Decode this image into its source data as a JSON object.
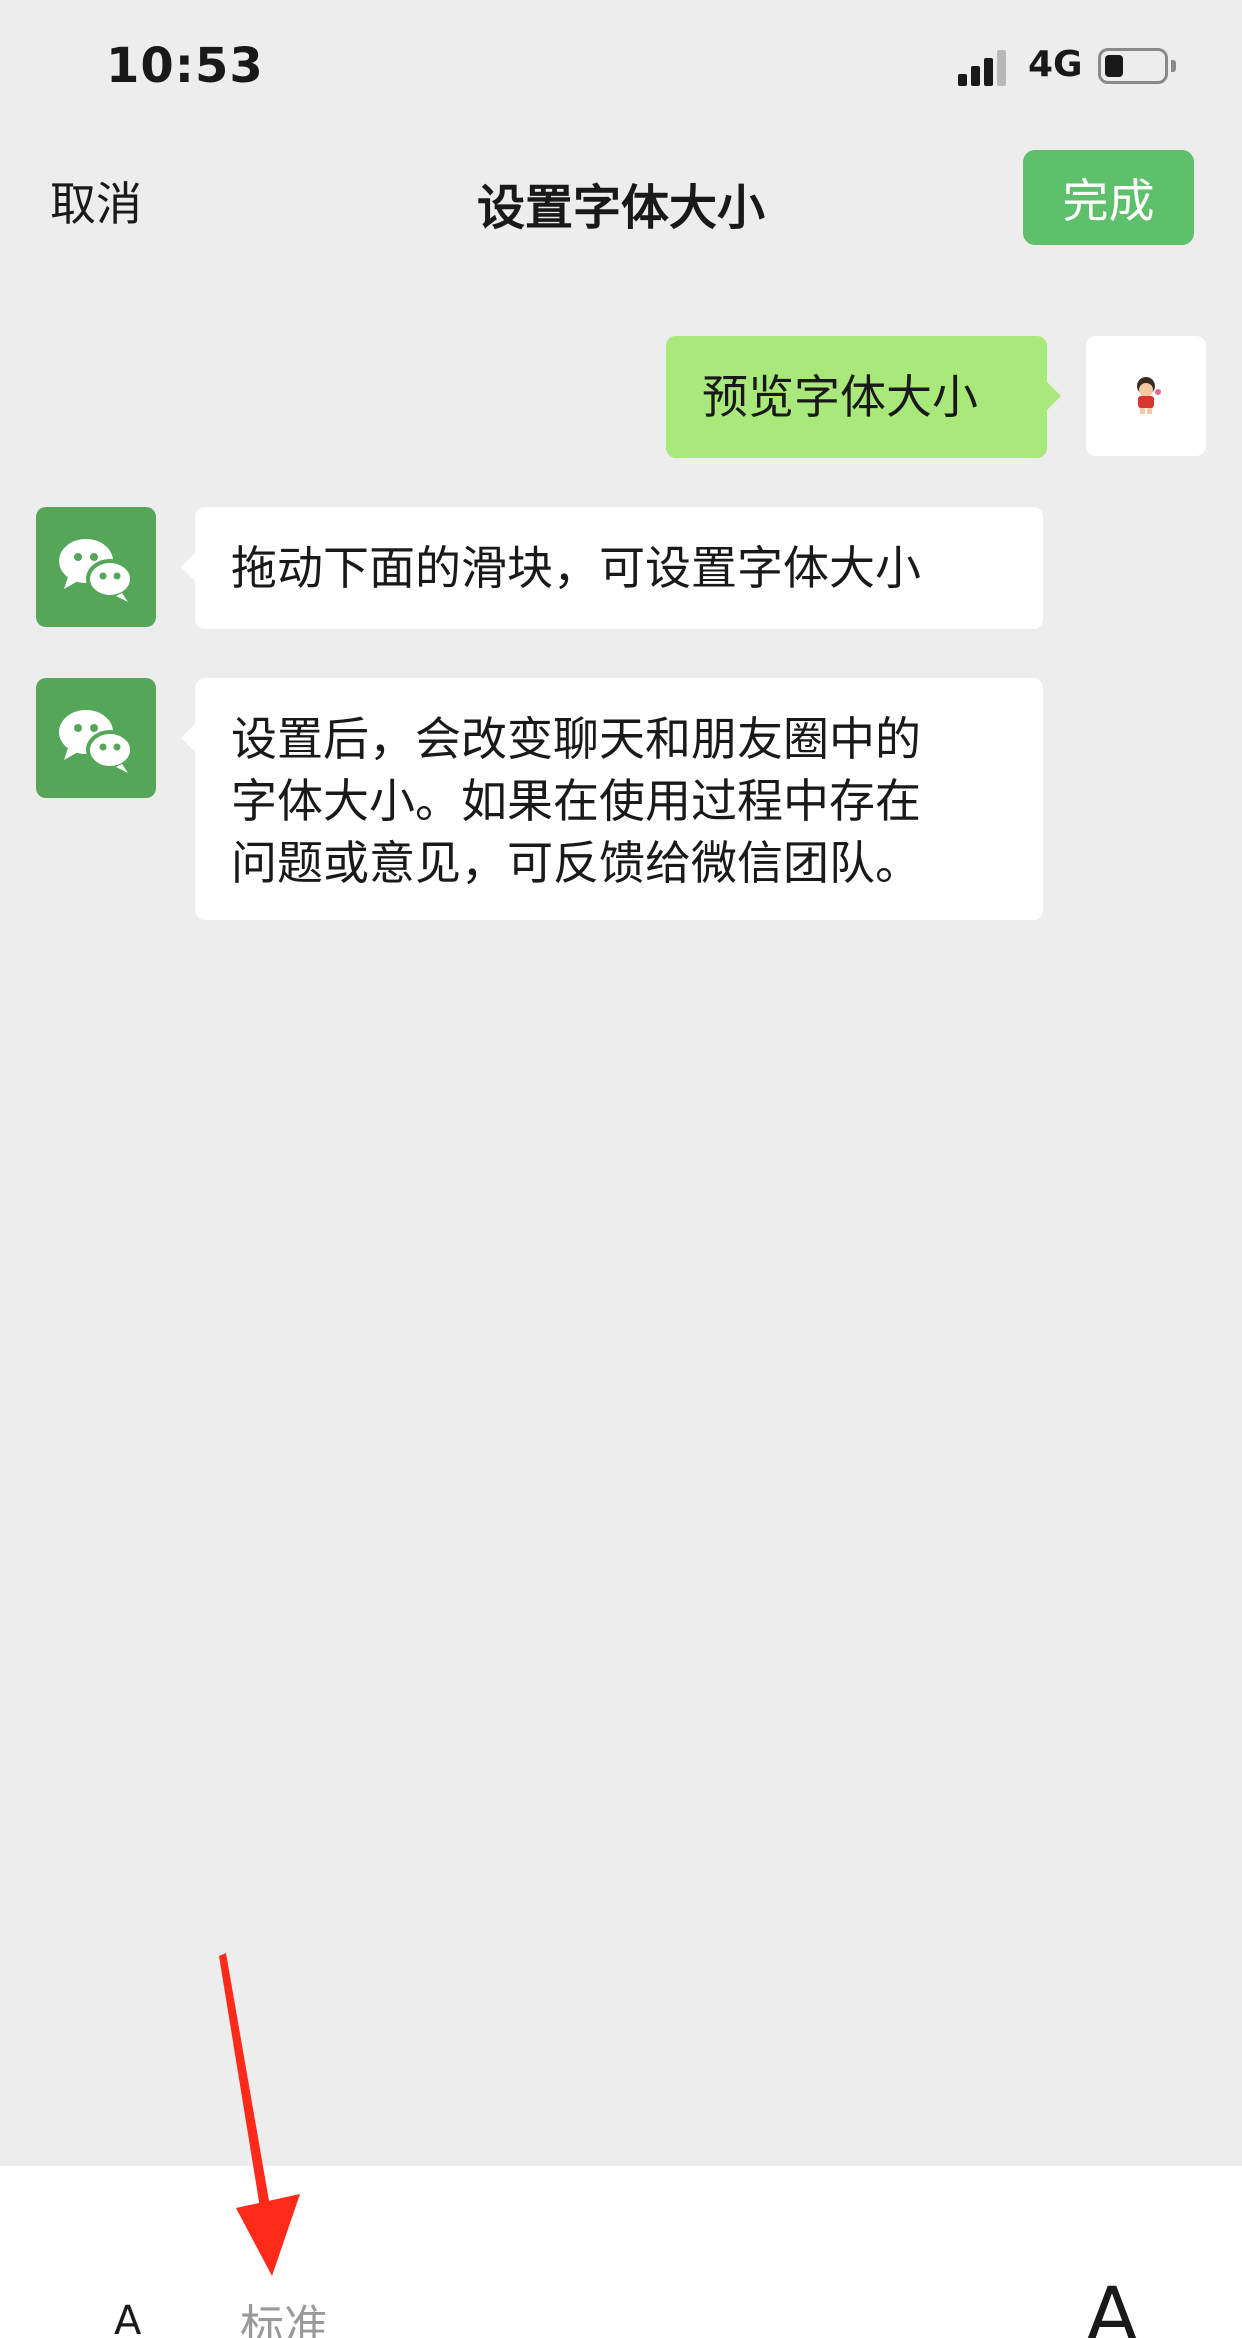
{
  "status_bar": {
    "time": "10:53",
    "network": "4G"
  },
  "nav": {
    "cancel": "取消",
    "title": "设置字体大小",
    "done": "完成"
  },
  "chat": {
    "outgoing": "预览字体大小",
    "incoming": [
      {
        "lines": [
          "拖动下面的滑块，可设置字体大小"
        ]
      },
      {
        "lines": [
          "设置后，会改变聊天和朋友圈中的",
          "字体大小。如果在使用过程中存在",
          "问题或意见，可反馈给微信团队。"
        ]
      }
    ]
  },
  "slider": {
    "small_label": "A",
    "current_label": "标准",
    "large_label": "A"
  },
  "colors": {
    "accent_green": "#5fc06c",
    "bubble_out": "#a9e87a",
    "wechat_avatar": "#55a659",
    "annotation_arrow": "#ff2a1a"
  },
  "icons": {
    "wechat_avatar": "wechat-logo-icon",
    "user_avatar": "sticker-avatar-icon"
  }
}
